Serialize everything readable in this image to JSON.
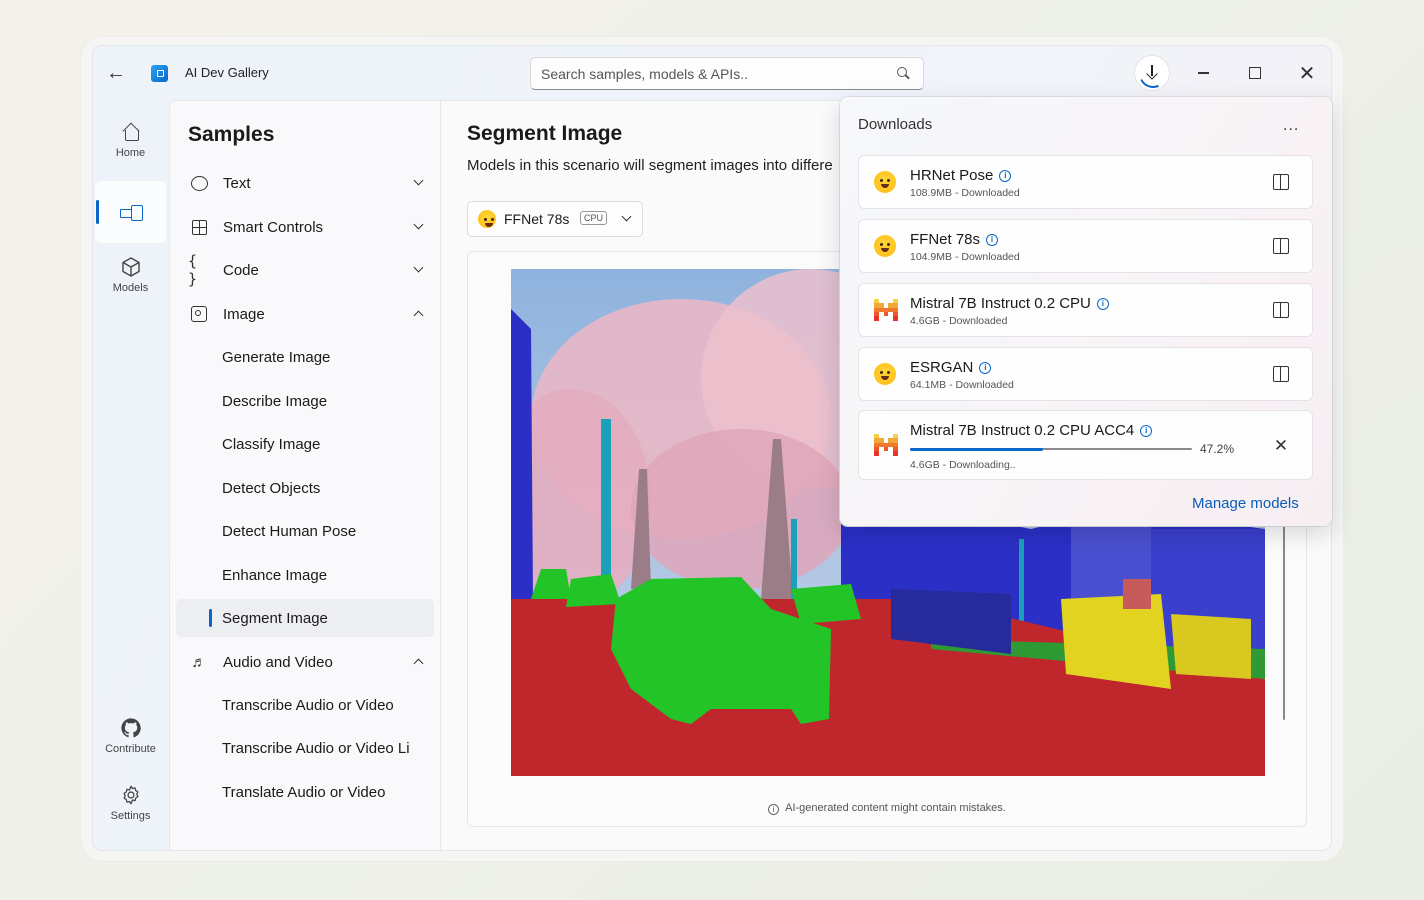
{
  "app": {
    "title": "AI Dev Gallery",
    "search_placeholder": "Search samples, models & APIs.."
  },
  "rail": {
    "items": [
      {
        "label": "Home",
        "icon": "home-icon"
      },
      {
        "label": "",
        "icon": "samples-icon",
        "selected": true
      },
      {
        "label": "Models",
        "icon": "cube-icon"
      },
      {
        "label": "Contribute",
        "icon": "github-icon"
      },
      {
        "label": "Settings",
        "icon": "gear-icon"
      }
    ]
  },
  "sidebar": {
    "title": "Samples",
    "items": [
      {
        "label": "Text",
        "icon": "chat-icon",
        "expanded": false
      },
      {
        "label": "Smart Controls",
        "icon": "grid-icon",
        "expanded": false
      },
      {
        "label": "Code",
        "icon": "braces-icon",
        "expanded": false
      },
      {
        "label": "Image",
        "icon": "image-icon",
        "expanded": true,
        "children": [
          "Generate Image",
          "Describe Image",
          "Classify Image",
          "Detect Objects",
          "Detect Human Pose",
          "Enhance Image",
          "Segment Image"
        ]
      },
      {
        "label": "Audio and Video",
        "icon": "audio-video-icon",
        "expanded": true,
        "children": [
          "Transcribe Audio or Video",
          "Transcribe Audio or Video Li",
          "Translate Audio or Video"
        ]
      }
    ],
    "selected": "Segment Image"
  },
  "main": {
    "title": "Segment Image",
    "description": "Models in this scenario will segment images into differe",
    "model_selector": {
      "name": "FFNet 78s",
      "badge": "CPU"
    },
    "disclaimer": "AI-generated content might contain mistakes."
  },
  "downloads": {
    "title": "Downloads",
    "more": "...",
    "items": [
      {
        "name": "HRNet Pose",
        "meta": "108.9MB - Downloaded",
        "logo": "huggingface-icon",
        "action": "open-folder-icon"
      },
      {
        "name": "FFNet 78s",
        "meta": "104.9MB - Downloaded",
        "logo": "huggingface-icon",
        "action": "open-folder-icon"
      },
      {
        "name": "Mistral 7B Instruct 0.2 CPU",
        "meta": "4.6GB - Downloaded",
        "logo": "mistral-icon",
        "action": "open-folder-icon"
      },
      {
        "name": "ESRGAN",
        "meta": "64.1MB - Downloaded",
        "logo": "huggingface-icon",
        "action": "open-folder-icon"
      },
      {
        "name": "Mistral 7B Instruct 0.2 CPU ACC4",
        "meta": "4.6GB - Downloading..",
        "logo": "mistral-icon",
        "action": "cancel-icon",
        "progress": 47.2,
        "progress_label": "47.2%"
      }
    ],
    "manage_label": "Manage models"
  },
  "colors": {
    "accent": "#0a66c8",
    "seg_road": "#c0272d",
    "seg_car": "#22c428",
    "seg_building": "#2b2fc6",
    "seg_pole": "#1aa0b8",
    "seg_person": "#e2d320"
  }
}
